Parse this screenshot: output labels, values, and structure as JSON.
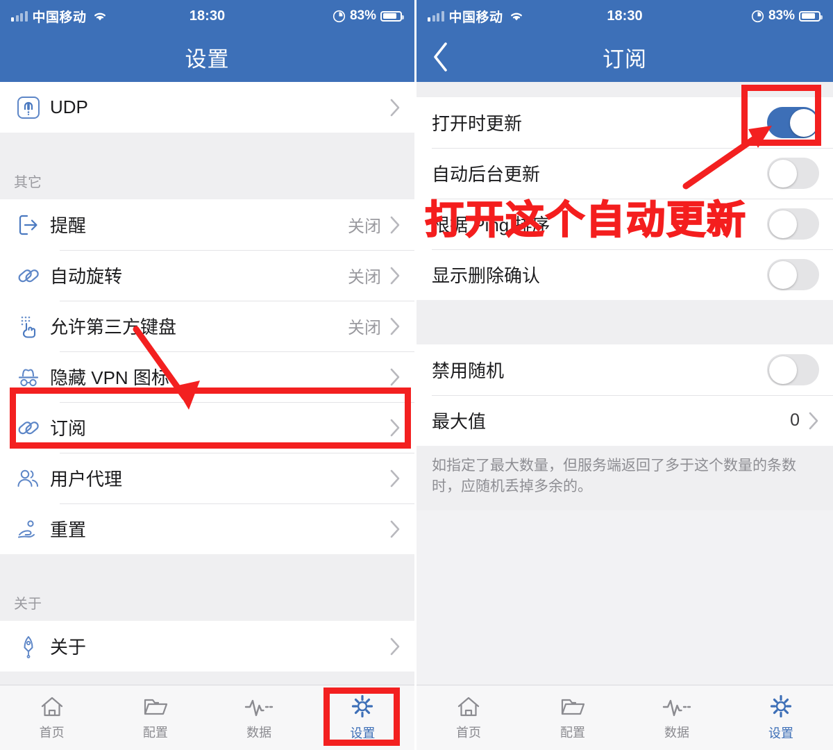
{
  "status_bar": {
    "carrier": "中国移动",
    "time": "18:30",
    "battery_percent": "83%",
    "signal_icon": "signal-bars-icon",
    "wifi_icon": "wifi-icon",
    "location_icon": "location-services-icon",
    "battery_icon": "battery-icon"
  },
  "colors": {
    "header_blue": "#3d70b8",
    "accent_blue": "#3d6fb7",
    "annotation_red": "#f32020",
    "list_bg": "#efeff1",
    "row_bg": "#ffffff",
    "muted_text": "#9a9a9f"
  },
  "left_screen": {
    "title": "设置",
    "groups": [
      {
        "header": "",
        "rows": [
          {
            "icon": "udp-icon",
            "label": "UDP",
            "value": "",
            "chevron": true
          }
        ]
      },
      {
        "header": "其它",
        "rows": [
          {
            "icon": "exit-arrow-icon",
            "label": "提醒",
            "value": "关闭",
            "chevron": true
          },
          {
            "icon": "link-icon",
            "label": "自动旋转",
            "value": "关闭",
            "chevron": true
          },
          {
            "icon": "keyboard-tap-icon",
            "label": "允许第三方键盘",
            "value": "关闭",
            "chevron": true
          },
          {
            "icon": "incognito-hat-icon",
            "label": "隐藏 VPN 图标",
            "value": "",
            "chevron": true
          },
          {
            "icon": "link-icon",
            "label": "订阅",
            "value": "",
            "chevron": true,
            "highlighted": true
          },
          {
            "icon": "users-icon",
            "label": "用户代理",
            "value": "",
            "chevron": true
          },
          {
            "icon": "reset-hand-icon",
            "label": "重置",
            "value": "",
            "chevron": true
          }
        ]
      },
      {
        "header": "关于",
        "rows": [
          {
            "icon": "rocket-icon",
            "label": "关于",
            "value": "",
            "chevron": true
          }
        ]
      }
    ],
    "tabs": [
      {
        "icon": "home-icon",
        "label": "首页",
        "active": false
      },
      {
        "icon": "folder-icon",
        "label": "配置",
        "active": false
      },
      {
        "icon": "pulse-icon",
        "label": "数据",
        "active": false
      },
      {
        "icon": "gear-icon",
        "label": "设置",
        "active": true
      }
    ]
  },
  "right_screen": {
    "title": "订阅",
    "back_icon": "chevron-left-icon",
    "groups": [
      {
        "rows": [
          {
            "label": "打开时更新",
            "control": "toggle",
            "toggle_on": true,
            "highlighted": true
          },
          {
            "label": "自动后台更新",
            "control": "toggle",
            "toggle_on": false
          },
          {
            "label": "根据 Ping 排序",
            "control": "toggle",
            "toggle_on": false
          },
          {
            "label": "显示删除确认",
            "control": "toggle",
            "toggle_on": false
          }
        ]
      },
      {
        "rows": [
          {
            "label": "禁用随机",
            "control": "toggle",
            "toggle_on": false
          },
          {
            "label": "最大值",
            "control": "value",
            "value": "0",
            "chevron": true
          }
        ]
      }
    ],
    "footer_note": "如指定了最大数量，但服务端返回了多于这个数量的条数时，应随机丢掉多余的。",
    "tabs": [
      {
        "icon": "home-icon",
        "label": "首页",
        "active": false
      },
      {
        "icon": "folder-icon",
        "label": "配置",
        "active": false
      },
      {
        "icon": "pulse-icon",
        "label": "数据",
        "active": false
      },
      {
        "icon": "gear-icon",
        "label": "设置",
        "active": true
      }
    ]
  },
  "annotations": {
    "left_arrow": "red-arrow-pointing-to-subscription-row",
    "left_box": "red-highlight-box-subscription-row",
    "left_tab_box": "red-highlight-box-settings-tab",
    "right_arrow": "red-arrow-pointing-to-update-on-open-toggle",
    "right_box": "red-highlight-box-update-on-open-toggle",
    "callout_text": "打开这个自动更新"
  }
}
